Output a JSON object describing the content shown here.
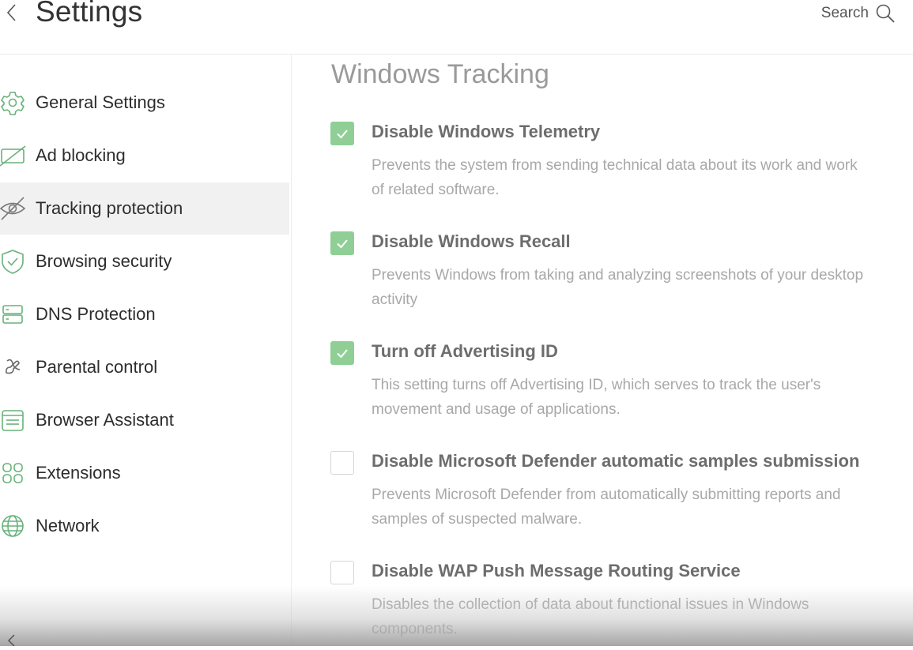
{
  "header": {
    "title": "Settings",
    "search_label": "Search"
  },
  "sidebar": {
    "items": [
      {
        "label": "General Settings",
        "icon": "gear-icon"
      },
      {
        "label": "Ad blocking",
        "icon": "ad-block-icon"
      },
      {
        "label": "Tracking protection",
        "icon": "eye-off-icon",
        "active": true
      },
      {
        "label": "Browsing security",
        "icon": "shield-check-icon"
      },
      {
        "label": "DNS Protection",
        "icon": "server-icon"
      },
      {
        "label": "Parental control",
        "icon": "parental-icon"
      },
      {
        "label": "Browser Assistant",
        "icon": "browser-assistant-icon"
      },
      {
        "label": "Extensions",
        "icon": "extensions-icon"
      },
      {
        "label": "Network",
        "icon": "globe-icon"
      }
    ]
  },
  "main": {
    "section_title": "Windows Tracking",
    "options": [
      {
        "title": "Disable Windows Telemetry",
        "description": "Prevents the system from sending technical data about its work and work of related software.",
        "checked": true
      },
      {
        "title": "Disable Windows Recall",
        "description": "Prevents Windows from taking and analyzing screenshots of your desktop activity",
        "checked": true
      },
      {
        "title": "Turn off Advertising ID",
        "description": "This setting turns off Advertising ID, which serves to track the user's movement and usage of applications.",
        "checked": true
      },
      {
        "title": "Disable Microsoft Defender automatic samples submission",
        "description": "Prevents Microsoft Defender from automatically submitting reports and samples of suspected malware.",
        "checked": false
      },
      {
        "title": "Disable WAP Push Message Routing Service",
        "description": "Disables the collection of data about functional issues in Windows components.",
        "checked": false
      }
    ]
  },
  "colors": {
    "accent_green": "#8fcf96",
    "icon_green": "#67b279"
  }
}
